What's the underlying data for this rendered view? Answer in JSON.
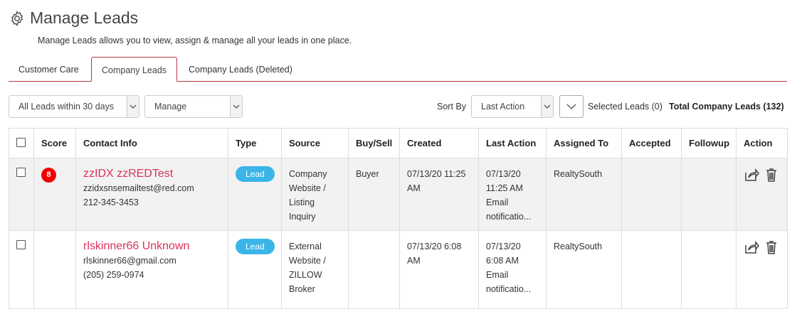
{
  "header": {
    "title": "Manage Leads",
    "subtitle": "Manage Leads allows you to view, assign & manage all your leads in one place."
  },
  "tabs": [
    {
      "label": "Customer Care"
    },
    {
      "label": "Company Leads"
    },
    {
      "label": "Company Leads (Deleted)"
    }
  ],
  "filters": {
    "range": "All Leads within 30 days",
    "manage": "Manage"
  },
  "sort": {
    "label": "Sort By",
    "value": "Last Action"
  },
  "selected_leads": "Selected Leads (0)",
  "total_leads": "Total Company Leads (132)",
  "columns": [
    "Score",
    "Contact Info",
    "Type",
    "Source",
    "Buy/Sell",
    "Created",
    "Last Action",
    "Assigned To",
    "Accepted",
    "Followup",
    "Action"
  ],
  "rows": [
    {
      "score": "8",
      "name": "zzIDX zzREDTest",
      "email": "zzidxsnsemailtest@red.com",
      "phone": "212-345-3453",
      "type": "Lead",
      "source": "Company Website / Listing Inquiry",
      "buysell": "Buyer",
      "created": "07/13/20 11:25 AM",
      "last_action_date": "07/13/20",
      "last_action_time": "11:25 AM",
      "last_action_note": "Email notificatio...",
      "assigned": "RealtySouth"
    },
    {
      "score": "",
      "name": "rlskinner66 Unknown",
      "email": "rlskinner66@gmail.com",
      "phone": "(205) 259-0974",
      "type": "Lead",
      "source": "External Website / ZILLOW Broker",
      "buysell": "",
      "created": "07/13/20 6:08 AM",
      "last_action_date": "07/13/20",
      "last_action_time": "6:08 AM",
      "last_action_note": "Email notificatio...",
      "assigned": "RealtySouth"
    }
  ],
  "colors": {
    "accent": "#b43a4a",
    "name_link": "#d9335b",
    "pill": "#3bb5e8",
    "score": "#ee0000"
  },
  "icons": [
    "gear-icon",
    "chevron-down-icon",
    "share-icon",
    "trash-icon"
  ]
}
